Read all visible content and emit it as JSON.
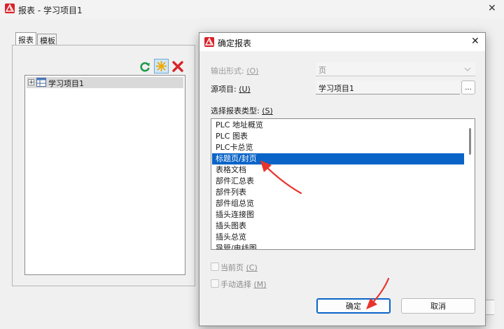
{
  "main_window": {
    "title": "报表 - 学习项目1",
    "close_glyph": "✕",
    "tabs": [
      "报表",
      "模板"
    ],
    "tree": {
      "expand_glyph": "+",
      "item_label": "学习项目1"
    }
  },
  "dialog": {
    "title": "确定报表",
    "close_glyph": "✕",
    "output_form": {
      "label": "输出形式:",
      "mnemonic": "(O)",
      "value": "页"
    },
    "source_project": {
      "label": "源项目:",
      "mnemonic": "(U)",
      "value": "学习项目1",
      "browse_label": "..."
    },
    "report_type": {
      "label": "选择报表类型:",
      "mnemonic": "(S)",
      "items": [
        "PLC 地址概览",
        "PLC 图表",
        "PLC卡总览",
        "标题页/封页",
        "表格文档",
        "部件汇总表",
        "部件列表",
        "部件组总览",
        "插头连接图",
        "插头图表",
        "插头总览",
        "导管/电线图"
      ],
      "selected_index": 3
    },
    "current_page": {
      "label": "当前页",
      "mnemonic": "(C)"
    },
    "manual_select": {
      "label": "手动选择",
      "mnemonic": "(M)"
    },
    "ok_label": "确定",
    "cancel_label": "取消"
  },
  "colors": {
    "selection": "#0a64c8",
    "arrow": "#e8342c",
    "logo": "#d8232a",
    "dialog_border": "#8a8a8a"
  },
  "icons": [
    "logo-icon",
    "refresh-icon",
    "new-icon",
    "delete-icon",
    "close-icon",
    "expand-icon",
    "table-icon",
    "chevron-down-icon"
  ]
}
